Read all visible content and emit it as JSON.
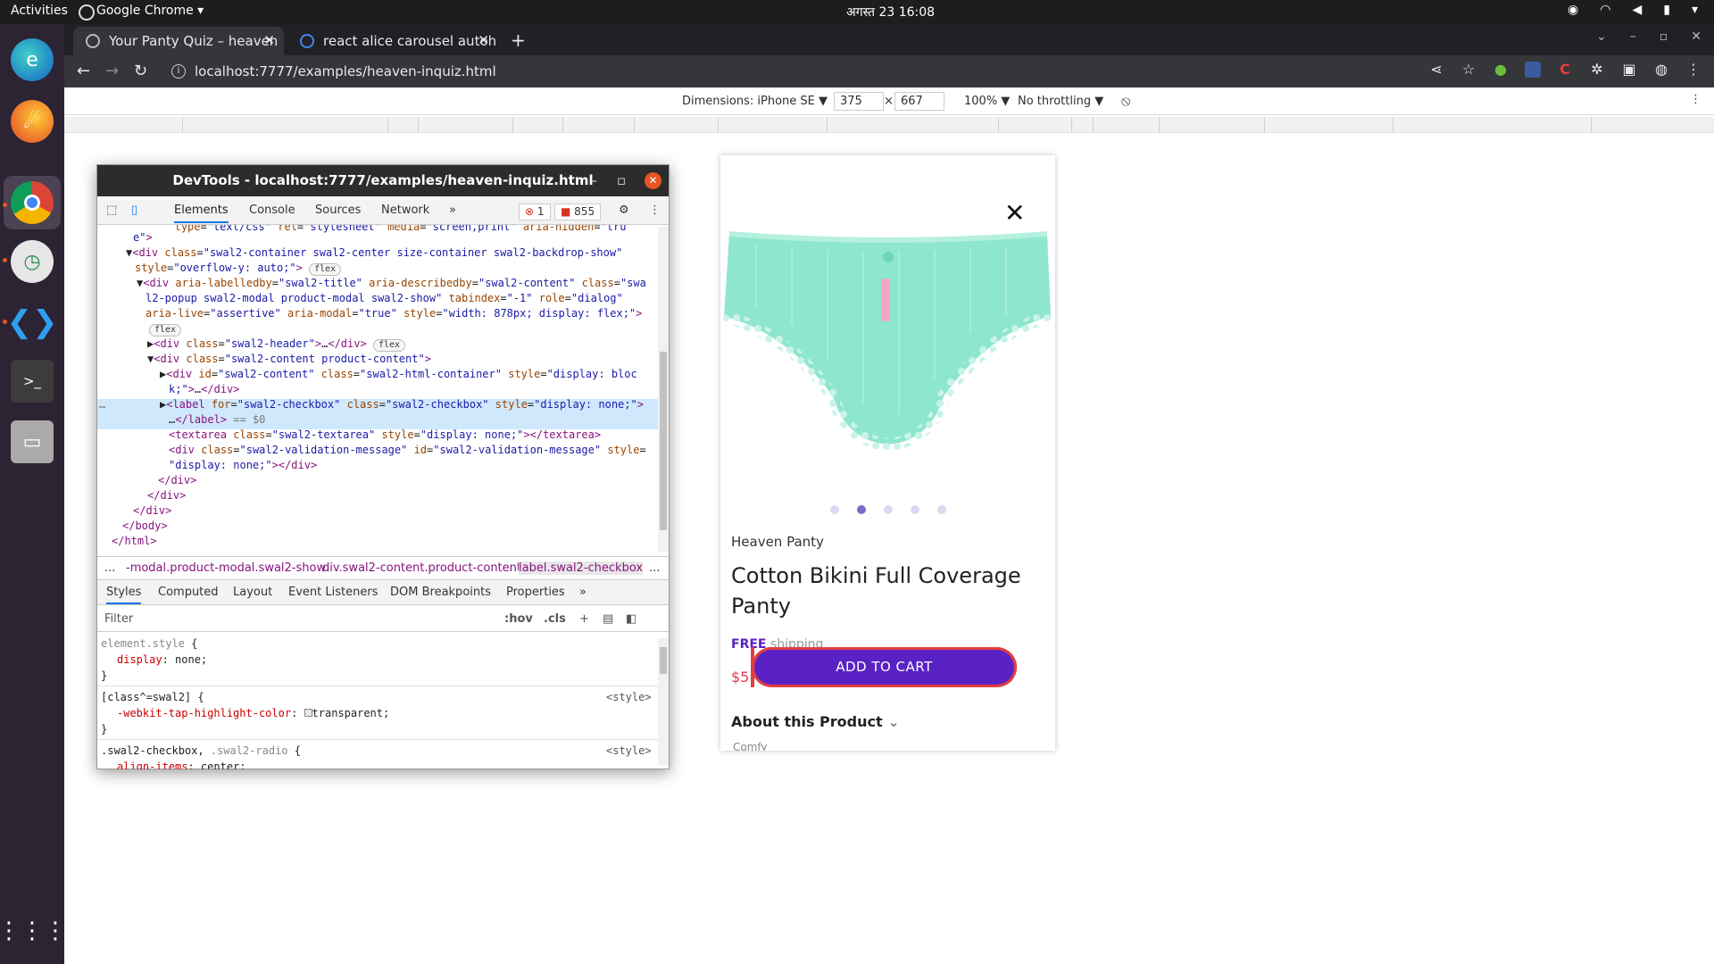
{
  "os": {
    "activities": "Activities",
    "app_name": "Google Chrome",
    "clock": "अगस्त 23  16:08"
  },
  "dock": [
    "edge-icon",
    "firefox-icon",
    "chrome-icon",
    "timeshift-icon",
    "vscode-icon",
    "terminal-icon",
    "files-icon",
    "apps-grid-icon"
  ],
  "browser": {
    "tabs": [
      {
        "title": "Your Panty Quiz – heaven",
        "close": "✕"
      },
      {
        "title": "react alice carousel autoh",
        "close": "✕"
      }
    ],
    "new_tab": "+",
    "url": "localhost:7777/examples/heaven-inquiz.html"
  },
  "device_toolbar": {
    "dimensions": "Dimensions: iPhone SE ▼",
    "width": "375",
    "times": "×",
    "height": "667",
    "zoom": "100% ▼",
    "throttling": "No throttling ▼"
  },
  "devtools": {
    "title": "DevTools - localhost:7777/examples/heaven-inquiz.html",
    "tabs": [
      "Elements",
      "Console",
      "Sources",
      "Network",
      "»"
    ],
    "errors": "1",
    "warnings": "855",
    "breadcrumbs": [
      "...",
      "-modal.product-modal.swal2-show",
      "div.swal2-content.product-content",
      "label.swal2-checkbox",
      "..."
    ],
    "style_tabs": [
      "Styles",
      "Computed",
      "Layout",
      "Event Listeners",
      "DOM Breakpoints",
      "Properties",
      "»"
    ],
    "filter_placeholder": "Filter",
    "hov": ":hov",
    "cls": ".cls"
  },
  "product": {
    "close": "✕",
    "brand": "Heaven Panty",
    "title": "Cotton Bikini Full Coverage Panty",
    "free": "FREE",
    "shipping": " shipping",
    "price": "$5.",
    "add_to_cart": "ADD TO CART",
    "about": "About this Product",
    "comfy": "Comfy",
    "carousel_active_index": 1,
    "carousel_count": 5,
    "product_color": "#8fe6cf"
  }
}
